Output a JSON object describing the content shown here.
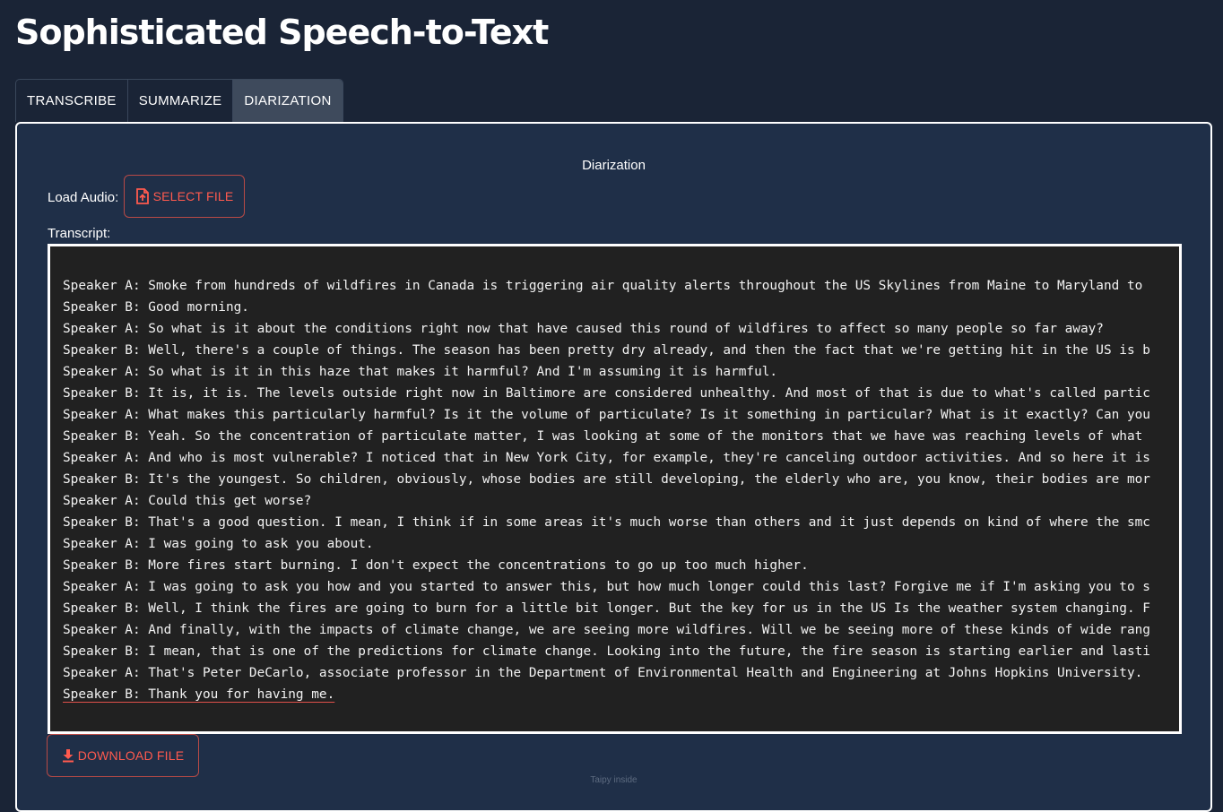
{
  "app": {
    "title": "Sophisticated Speech-to-Text"
  },
  "tabs": [
    {
      "label": "TRANSCRIBE",
      "active": false
    },
    {
      "label": "SUMMARIZE",
      "active": false
    },
    {
      "label": "DIARIZATION",
      "active": true
    }
  ],
  "diarization": {
    "section_title": "Diarization",
    "load_audio_label": "Load Audio:",
    "select_file_label": "SELECT FILE",
    "transcript_label": "Transcript:",
    "download_label": "DOWNLOAD FILE",
    "transcript_lines": [
      "Speaker A: Smoke from hundreds of wildfires in Canada is triggering air quality alerts throughout the US Skylines from Maine to Maryland to",
      "Speaker B: Good morning.",
      "Speaker A: So what is it about the conditions right now that have caused this round of wildfires to affect so many people so far away?",
      "Speaker B: Well, there's a couple of things. The season has been pretty dry already, and then the fact that we're getting hit in the US is b",
      "Speaker A: So what is it in this haze that makes it harmful? And I'm assuming it is harmful.",
      "Speaker B: It is, it is. The levels outside right now in Baltimore are considered unhealthy. And most of that is due to what's called partic",
      "Speaker A: What makes this particularly harmful? Is it the volume of particulate? Is it something in particular? What is it exactly? Can you",
      "Speaker B: Yeah. So the concentration of particulate matter, I was looking at some of the monitors that we have was reaching levels of what",
      "Speaker A: And who is most vulnerable? I noticed that in New York City, for example, they're canceling outdoor activities. And so here it is",
      "Speaker B: It's the youngest. So children, obviously, whose bodies are still developing, the elderly who are, you know, their bodies are mor",
      "Speaker A: Could this get worse?",
      "Speaker B: That's a good question. I mean, I think if in some areas it's much worse than others and it just depends on kind of where the smc",
      "Speaker A: I was going to ask you about.",
      "Speaker B: More fires start burning. I don't expect the concentrations to go up too much higher.",
      "Speaker A: I was going to ask you how and you started to answer this, but how much longer could this last? Forgive me if I'm asking you to s",
      "Speaker B: Well, I think the fires are going to burn for a little bit longer. But the key for us in the US Is the weather system changing. F",
      "Speaker A: And finally, with the impacts of climate change, we are seeing more wildfires. Will we be seeing more of these kinds of wide rang",
      "Speaker B: I mean, that is one of the predictions for climate change. Looking into the future, the fire season is starting earlier and lasti",
      "Speaker A: That's Peter DeCarlo, associate professor in the Department of Environmental Health and Engineering at Johns Hopkins University.",
      "Speaker B: Thank you for having me."
    ]
  },
  "footer": {
    "note": "Taipy inside"
  },
  "icons": {
    "select_file": "file-upload-icon",
    "download": "download-icon"
  },
  "colors": {
    "background": "#1a2436",
    "panel": "#1f2f48",
    "accent": "#ff5a4e",
    "transcript_bg": "#212121"
  }
}
